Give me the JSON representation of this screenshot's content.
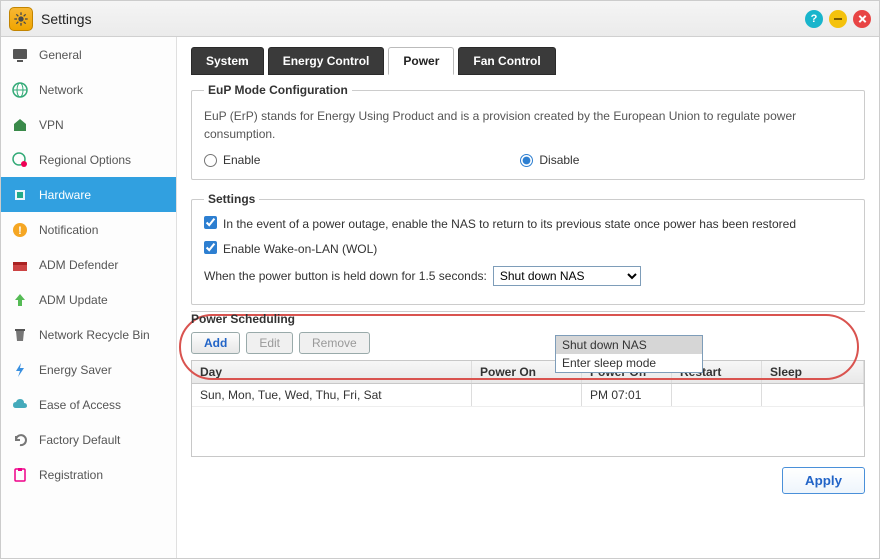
{
  "window": {
    "title": "Settings"
  },
  "titlebar_icons": {
    "help": "?",
    "minimize": "–",
    "close": "×"
  },
  "sidebar": {
    "items": [
      {
        "label": "General"
      },
      {
        "label": "Network"
      },
      {
        "label": "VPN"
      },
      {
        "label": "Regional Options"
      },
      {
        "label": "Hardware"
      },
      {
        "label": "Notification"
      },
      {
        "label": "ADM Defender"
      },
      {
        "label": "ADM Update"
      },
      {
        "label": "Network Recycle Bin"
      },
      {
        "label": "Energy Saver"
      },
      {
        "label": "Ease of Access"
      },
      {
        "label": "Factory Default"
      },
      {
        "label": "Registration"
      }
    ],
    "active_index": 4
  },
  "tabs": {
    "items": [
      "System",
      "Energy Control",
      "Power",
      "Fan Control"
    ],
    "active_index": 2
  },
  "eup": {
    "legend": "EuP Mode Configuration",
    "desc": "EuP (ErP) stands for Energy Using Product and is a provision created by the European Union to regulate power consumption.",
    "enable_label": "Enable",
    "disable_label": "Disable",
    "value": "disable"
  },
  "settings": {
    "legend": "Settings",
    "outage_label": "In the event of a power outage, enable the NAS to return to its previous state once power has been restored",
    "outage_checked": true,
    "wol_label": "Enable Wake-on-LAN (WOL)",
    "wol_checked": true,
    "hold_label": "When the power button is held down for 1.5 seconds:",
    "hold_value": "Shut down NAS",
    "hold_options": [
      "Shut down NAS",
      "Enter sleep mode"
    ]
  },
  "power_scheduling": {
    "legend": "Power Scheduling",
    "buttons": {
      "add": "Add",
      "edit": "Edit",
      "remove": "Remove"
    },
    "columns": {
      "day": "Day",
      "on": "Power On",
      "off": "Power Off",
      "restart": "Restart",
      "sleep": "Sleep"
    },
    "rows": [
      {
        "day": "Sun, Mon, Tue, Wed, Thu, Fri, Sat",
        "on": "",
        "off": "PM 07:01",
        "restart": "",
        "sleep": ""
      }
    ]
  },
  "footer": {
    "apply": "Apply"
  }
}
